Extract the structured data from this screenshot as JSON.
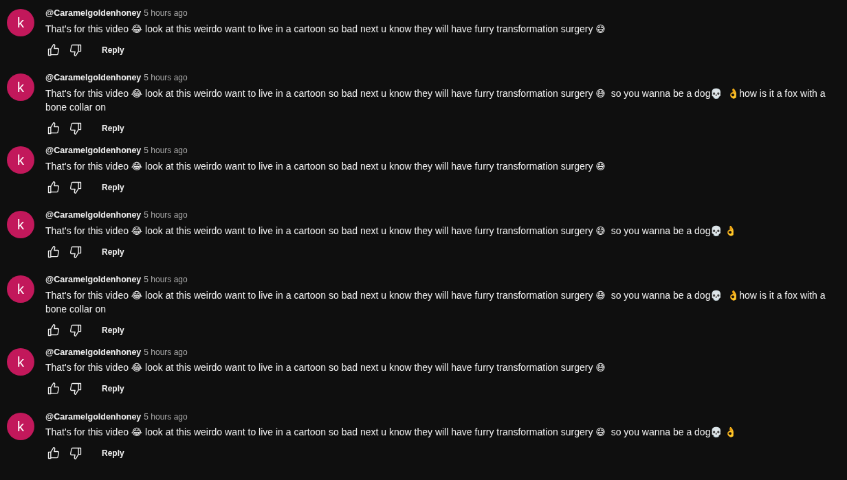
{
  "comments": [
    {
      "avatar": "k",
      "author": "@Caramelgoldenhoney",
      "time": "5 hours ago",
      "text": "That's for this video 😂 look at this weirdo want to live in a cartoon so bad next u know they will have furry transformation surgery 😅",
      "reply": "Reply"
    },
    {
      "avatar": "k",
      "author": "@Caramelgoldenhoney",
      "time": "5 hours ago",
      "text": "That's for this video 😂 look at this weirdo want to live in a cartoon so bad next u know they will have furry transformation surgery 😅  so you wanna be a dog💀  👌how is it a fox with a bone collar on",
      "reply": "Reply"
    },
    {
      "avatar": "k",
      "author": "@Caramelgoldenhoney",
      "time": "5 hours ago",
      "text": "That's for this video 😂 look at this weirdo want to live in a cartoon so bad next u know they will have furry transformation surgery 😅",
      "reply": "Reply"
    },
    {
      "avatar": "k",
      "author": "@Caramelgoldenhoney",
      "time": "5 hours ago",
      "text": "That's for this video 😂 look at this weirdo want to live in a cartoon so bad next u know they will have furry transformation surgery 😅  so you wanna be a dog💀 👌",
      "reply": "Reply"
    },
    {
      "avatar": "k",
      "author": "@Caramelgoldenhoney",
      "time": "5 hours ago",
      "text": "That's for this video 😂 look at this weirdo want to live in a cartoon so bad next u know they will have furry transformation surgery 😅  so you wanna be a dog💀  👌how is it a fox with a bone collar on",
      "reply": "Reply"
    },
    {
      "avatar": "k",
      "author": "@Caramelgoldenhoney",
      "time": "5 hours ago",
      "text": "That's for this video 😂 look at this weirdo want to live in a cartoon so bad next u know they will have furry transformation surgery 😅",
      "reply": "Reply"
    },
    {
      "avatar": "k",
      "author": "@Caramelgoldenhoney",
      "time": "5 hours ago",
      "text": "That's for this video 😂 look at this weirdo want to live in a cartoon so bad next u know they will have furry transformation surgery 😅  so you wanna be a dog💀 👌",
      "reply": "Reply"
    }
  ]
}
